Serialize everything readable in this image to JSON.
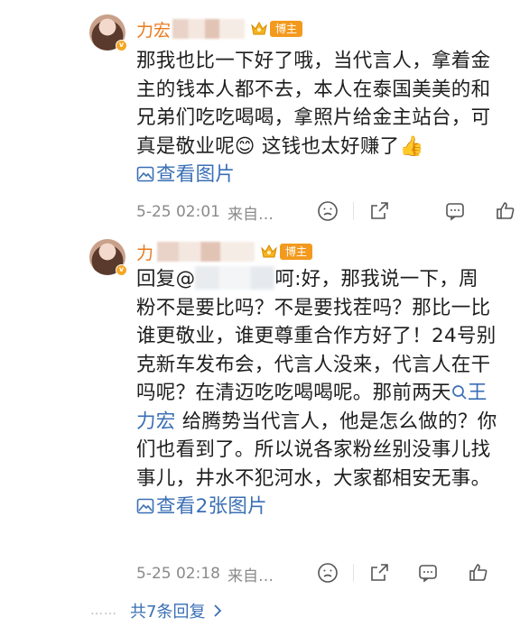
{
  "comments": [
    {
      "author_visible": "力宏",
      "badge": "博主",
      "text": "那我也比一下好了哦，当代言人，拿着金主的钱本人都不去，本人在泰国美美的和兄弟们吃吃喝喝，拿照片给金主站台，可真是敬业呢",
      "emoji_1": "😊",
      "text_2": "这钱也太好赚了",
      "emoji_2": "👍",
      "image_link": "查看图片",
      "time": "5-25 02:01",
      "source": "来自…"
    },
    {
      "author_visible": "力",
      "badge": "博主",
      "reply_prefix": "回复@",
      "reply_suffix": "呵:好，那我说一下，周粉不是要比吗？不是要找茬吗？那比一比谁更敬业，谁更尊重合作方好了！24号别克新车发布会，代言人没来，代言人在干吗呢？在清迈吃吃喝喝呢。那前两天",
      "mention": "王力宏",
      "text_2": " 给腾势当代言人，他是怎么做的？你们也看到了。所以说各家粉丝别没事儿找事儿，井水不犯河水，大家都相安无事。",
      "image_link": "查看2张图片",
      "time": "5-25 02:18",
      "source": "来自…"
    }
  ],
  "replies_link": "共7条回复",
  "replies_dots": "……",
  "icons": {
    "verified": "v-badge-icon",
    "crown": "crown-icon",
    "picture": "picture-icon",
    "dislike": "frown-icon",
    "share": "share-icon",
    "comment": "comment-icon",
    "like": "thumbs-up-icon",
    "search": "search-icon",
    "chevron": "chevron-right-icon"
  },
  "colors": {
    "name": "#ea7a1d",
    "badge": "#f39a1e",
    "link": "#3a6fb5",
    "meta": "#8a8a8a"
  }
}
